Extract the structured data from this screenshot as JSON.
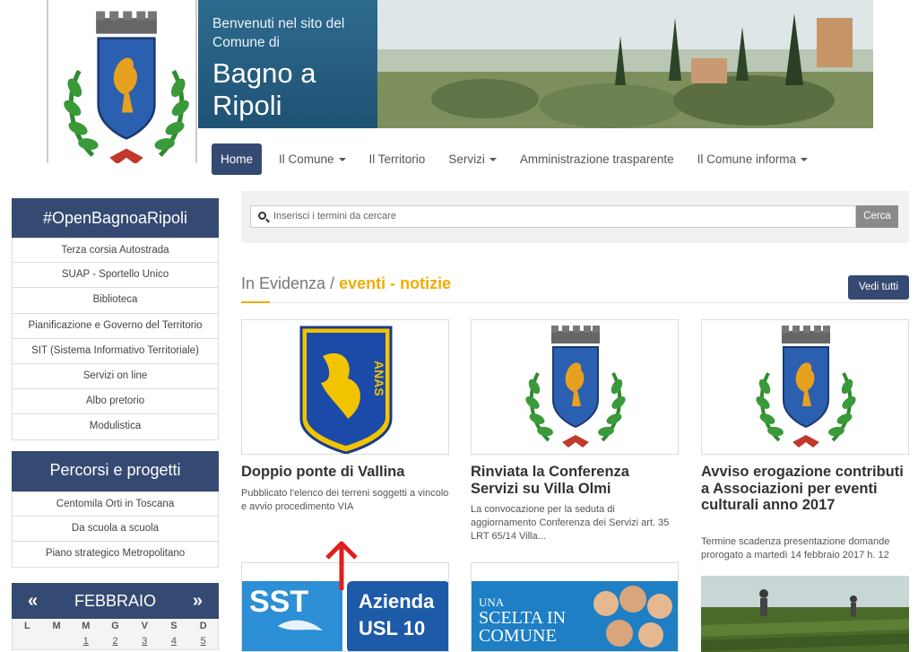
{
  "banner": {
    "welcome": "Benvenuti nel sito del Comune di",
    "name": "Bagno a Ripoli"
  },
  "nav": {
    "items": [
      {
        "label": "Home",
        "active": true,
        "dropdown": false
      },
      {
        "label": "Il Comune",
        "dropdown": true
      },
      {
        "label": "Il Territorio",
        "dropdown": false
      },
      {
        "label": "Servizi",
        "dropdown": true
      },
      {
        "label": "Amministrazione trasparente",
        "dropdown": false
      },
      {
        "label": "Il Comune informa",
        "dropdown": true
      }
    ]
  },
  "sidebar": {
    "open": {
      "title": "#OpenBagnoaRipoli",
      "items": [
        "Terza corsia Autostrada",
        "SUAP - Sportello Unico",
        "Biblioteca",
        "Pianificazione e Governo del Territorio",
        "SIT (Sistema Informativo Territoriale)",
        "Servizi on line",
        "Albo pretorio",
        "Modulistica"
      ]
    },
    "percorsi": {
      "title": "Percorsi e progetti",
      "items": [
        "Centomila Orti in Toscana",
        "Da scuola a scuola",
        "Piano strategico Metropolitano"
      ]
    }
  },
  "calendar": {
    "month": "FEBBRAIO",
    "prev": "«",
    "next": "»",
    "days": [
      "L",
      "M",
      "M",
      "G",
      "V",
      "S",
      "D"
    ],
    "first_row": [
      "",
      "",
      "1",
      "2",
      "3",
      "4",
      "5"
    ]
  },
  "search": {
    "placeholder": "Inserisci i termini da cercare",
    "button": "Cerca"
  },
  "section": {
    "title_prefix": "In Evidenza /",
    "title_highlight": "eventi - notizie",
    "view_all": "Vedi tutti"
  },
  "cards": [
    {
      "title": "Doppio ponte di Vallina",
      "text": "Pubblicato l'elenco dei terreni soggetti a vincolo e avvio procedimento VIA",
      "image": "anas-logo"
    },
    {
      "title": "Rinviata la Conferenza Servizi su Villa Olmi",
      "text": "La convocazione per la seduta di aggiornamento Conferenza dei Servizi  art. 35 LRT 65/14 Villa...",
      "image": "crest"
    },
    {
      "title": "Avviso erogazione contributi a Associazioni per eventi culturali anno 2017",
      "text": "Termine scadenza presentazione domande prorogato a martedì 14 febbraio 2017 h. 12",
      "image": "crest"
    }
  ],
  "cards_row2": [
    {
      "badge_left": "SST",
      "badge_right_1": "Azienda",
      "badge_right_2": "USL 10"
    },
    {
      "line1": "UNA",
      "line2": "SCELTA IN",
      "line3": "COMUNE"
    },
    {
      "image": "field-workers"
    }
  ],
  "colors": {
    "navy": "#354a72",
    "accent": "#f0ad00",
    "banner_blue": "#2e6b8f"
  }
}
